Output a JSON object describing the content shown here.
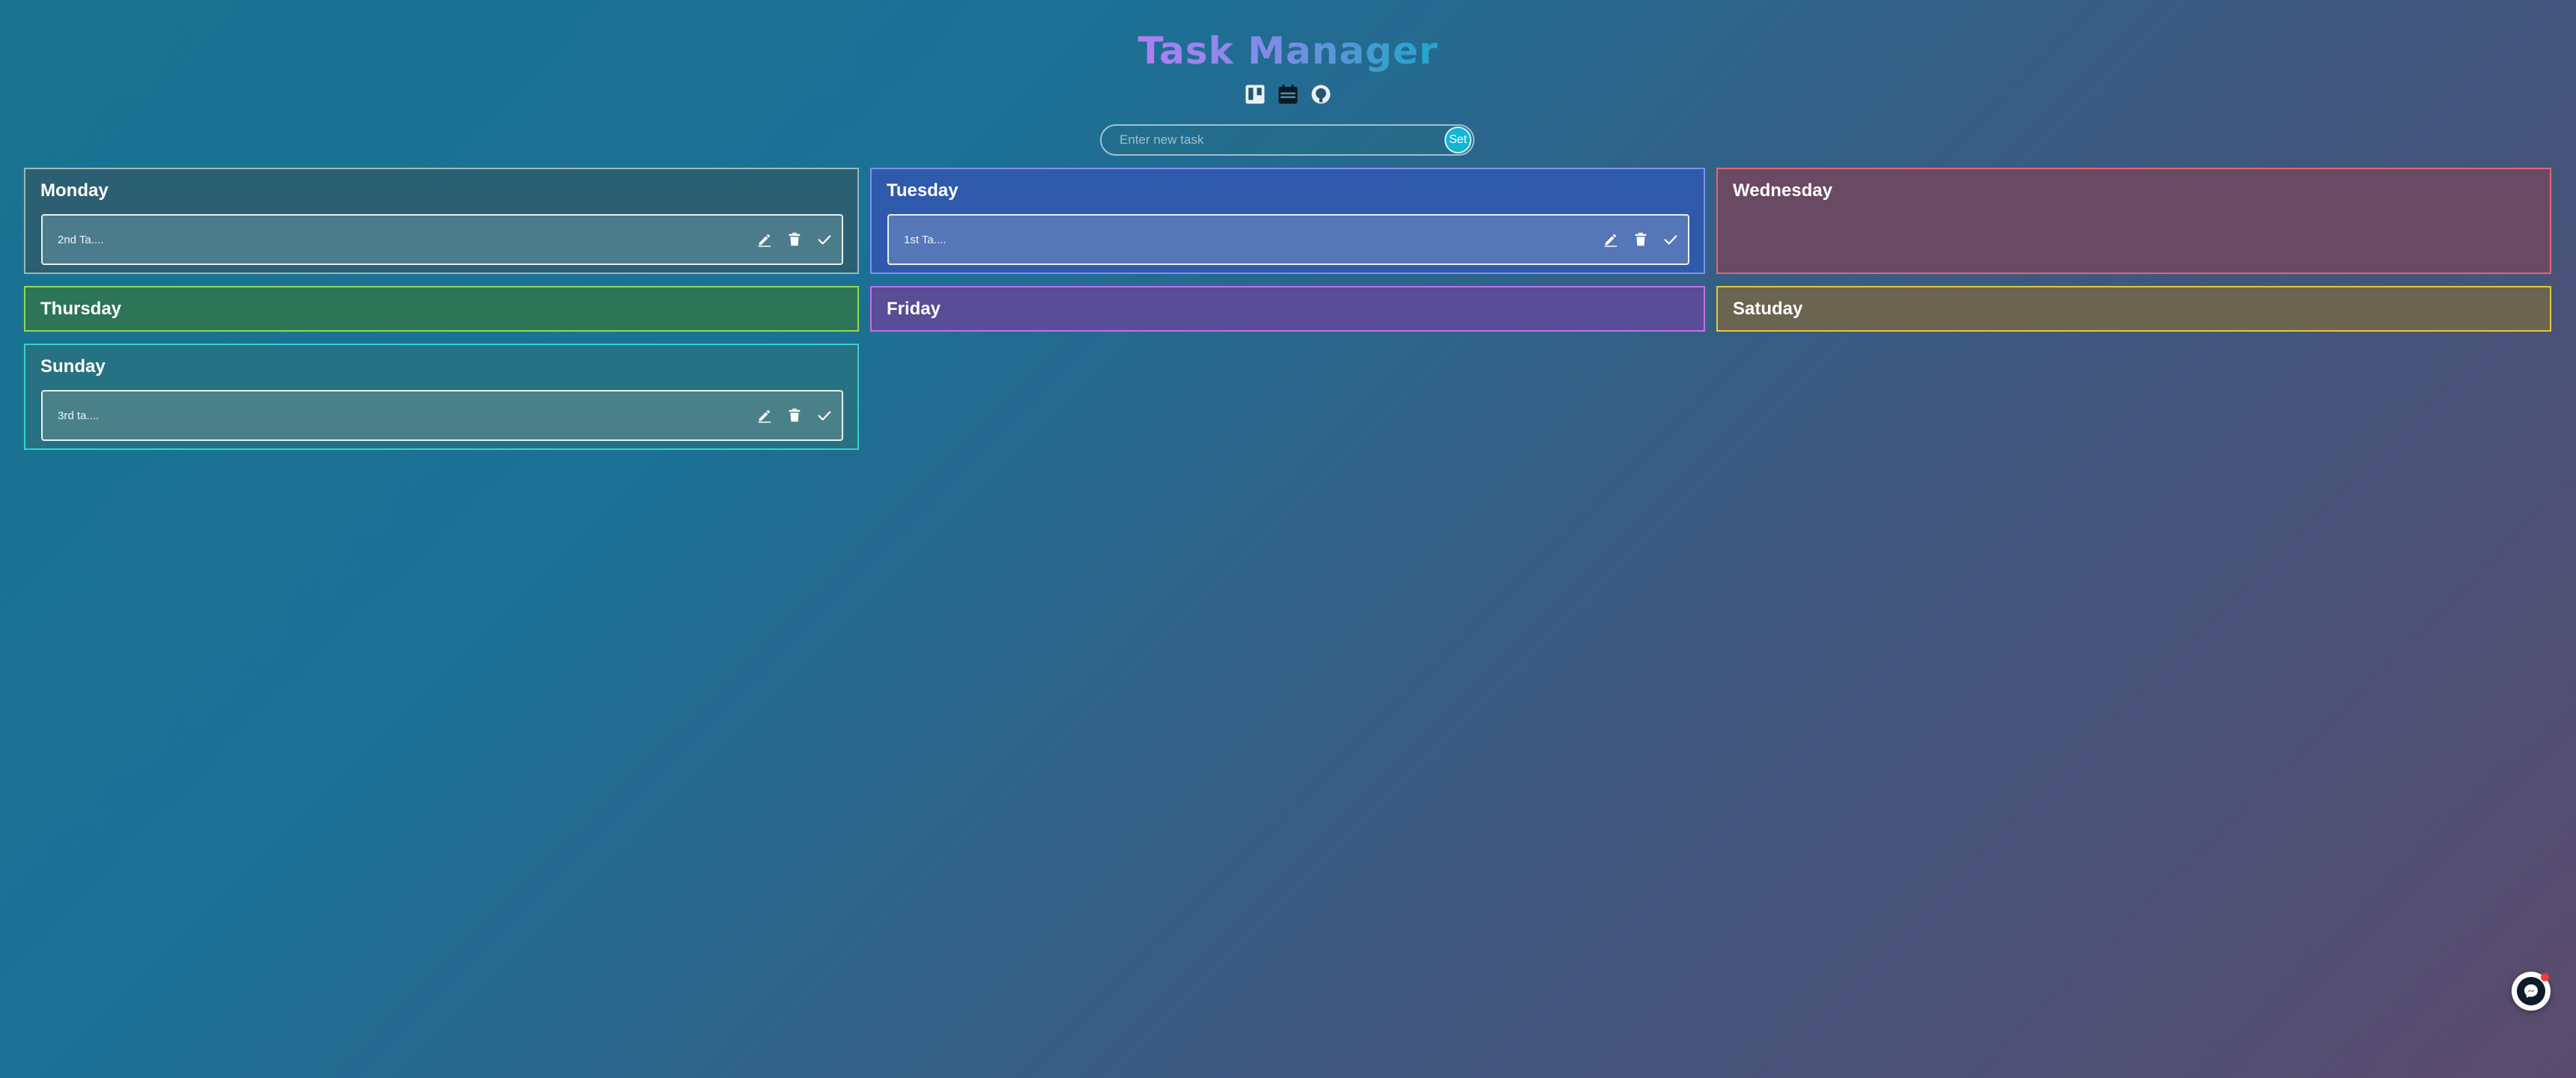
{
  "header": {
    "title": "Task Manager",
    "icons": [
      "kanban-icon",
      "calendar-icon",
      "github-icon"
    ]
  },
  "form": {
    "placeholder": "Enter new task",
    "value": "",
    "submit_label": "Set"
  },
  "days": [
    {
      "name": "Monday",
      "tasks": [
        "2nd Ta...."
      ]
    },
    {
      "name": "Tuesday",
      "tasks": [
        "1st Ta...."
      ]
    },
    {
      "name": "Wednesday",
      "tasks": []
    },
    {
      "name": "Thursday",
      "tasks": []
    },
    {
      "name": "Friday",
      "tasks": []
    },
    {
      "name": "Satuday",
      "tasks": []
    },
    {
      "name": "Sunday",
      "tasks": [
        "3rd ta...."
      ]
    }
  ],
  "task_actions": [
    "edit-icon",
    "delete-icon",
    "check-icon"
  ],
  "colors": {
    "monday": "#9ab7bf",
    "tuesday": "#7c93e8",
    "wednesday": "#e26675",
    "thursday": "#8edb55",
    "friday": "#c071e6",
    "saturday": "#e0c840",
    "sunday": "#33d2cf",
    "accent": "#11b6d6"
  },
  "chat_widget": {
    "icon": "messenger-icon",
    "has_notification": true
  }
}
